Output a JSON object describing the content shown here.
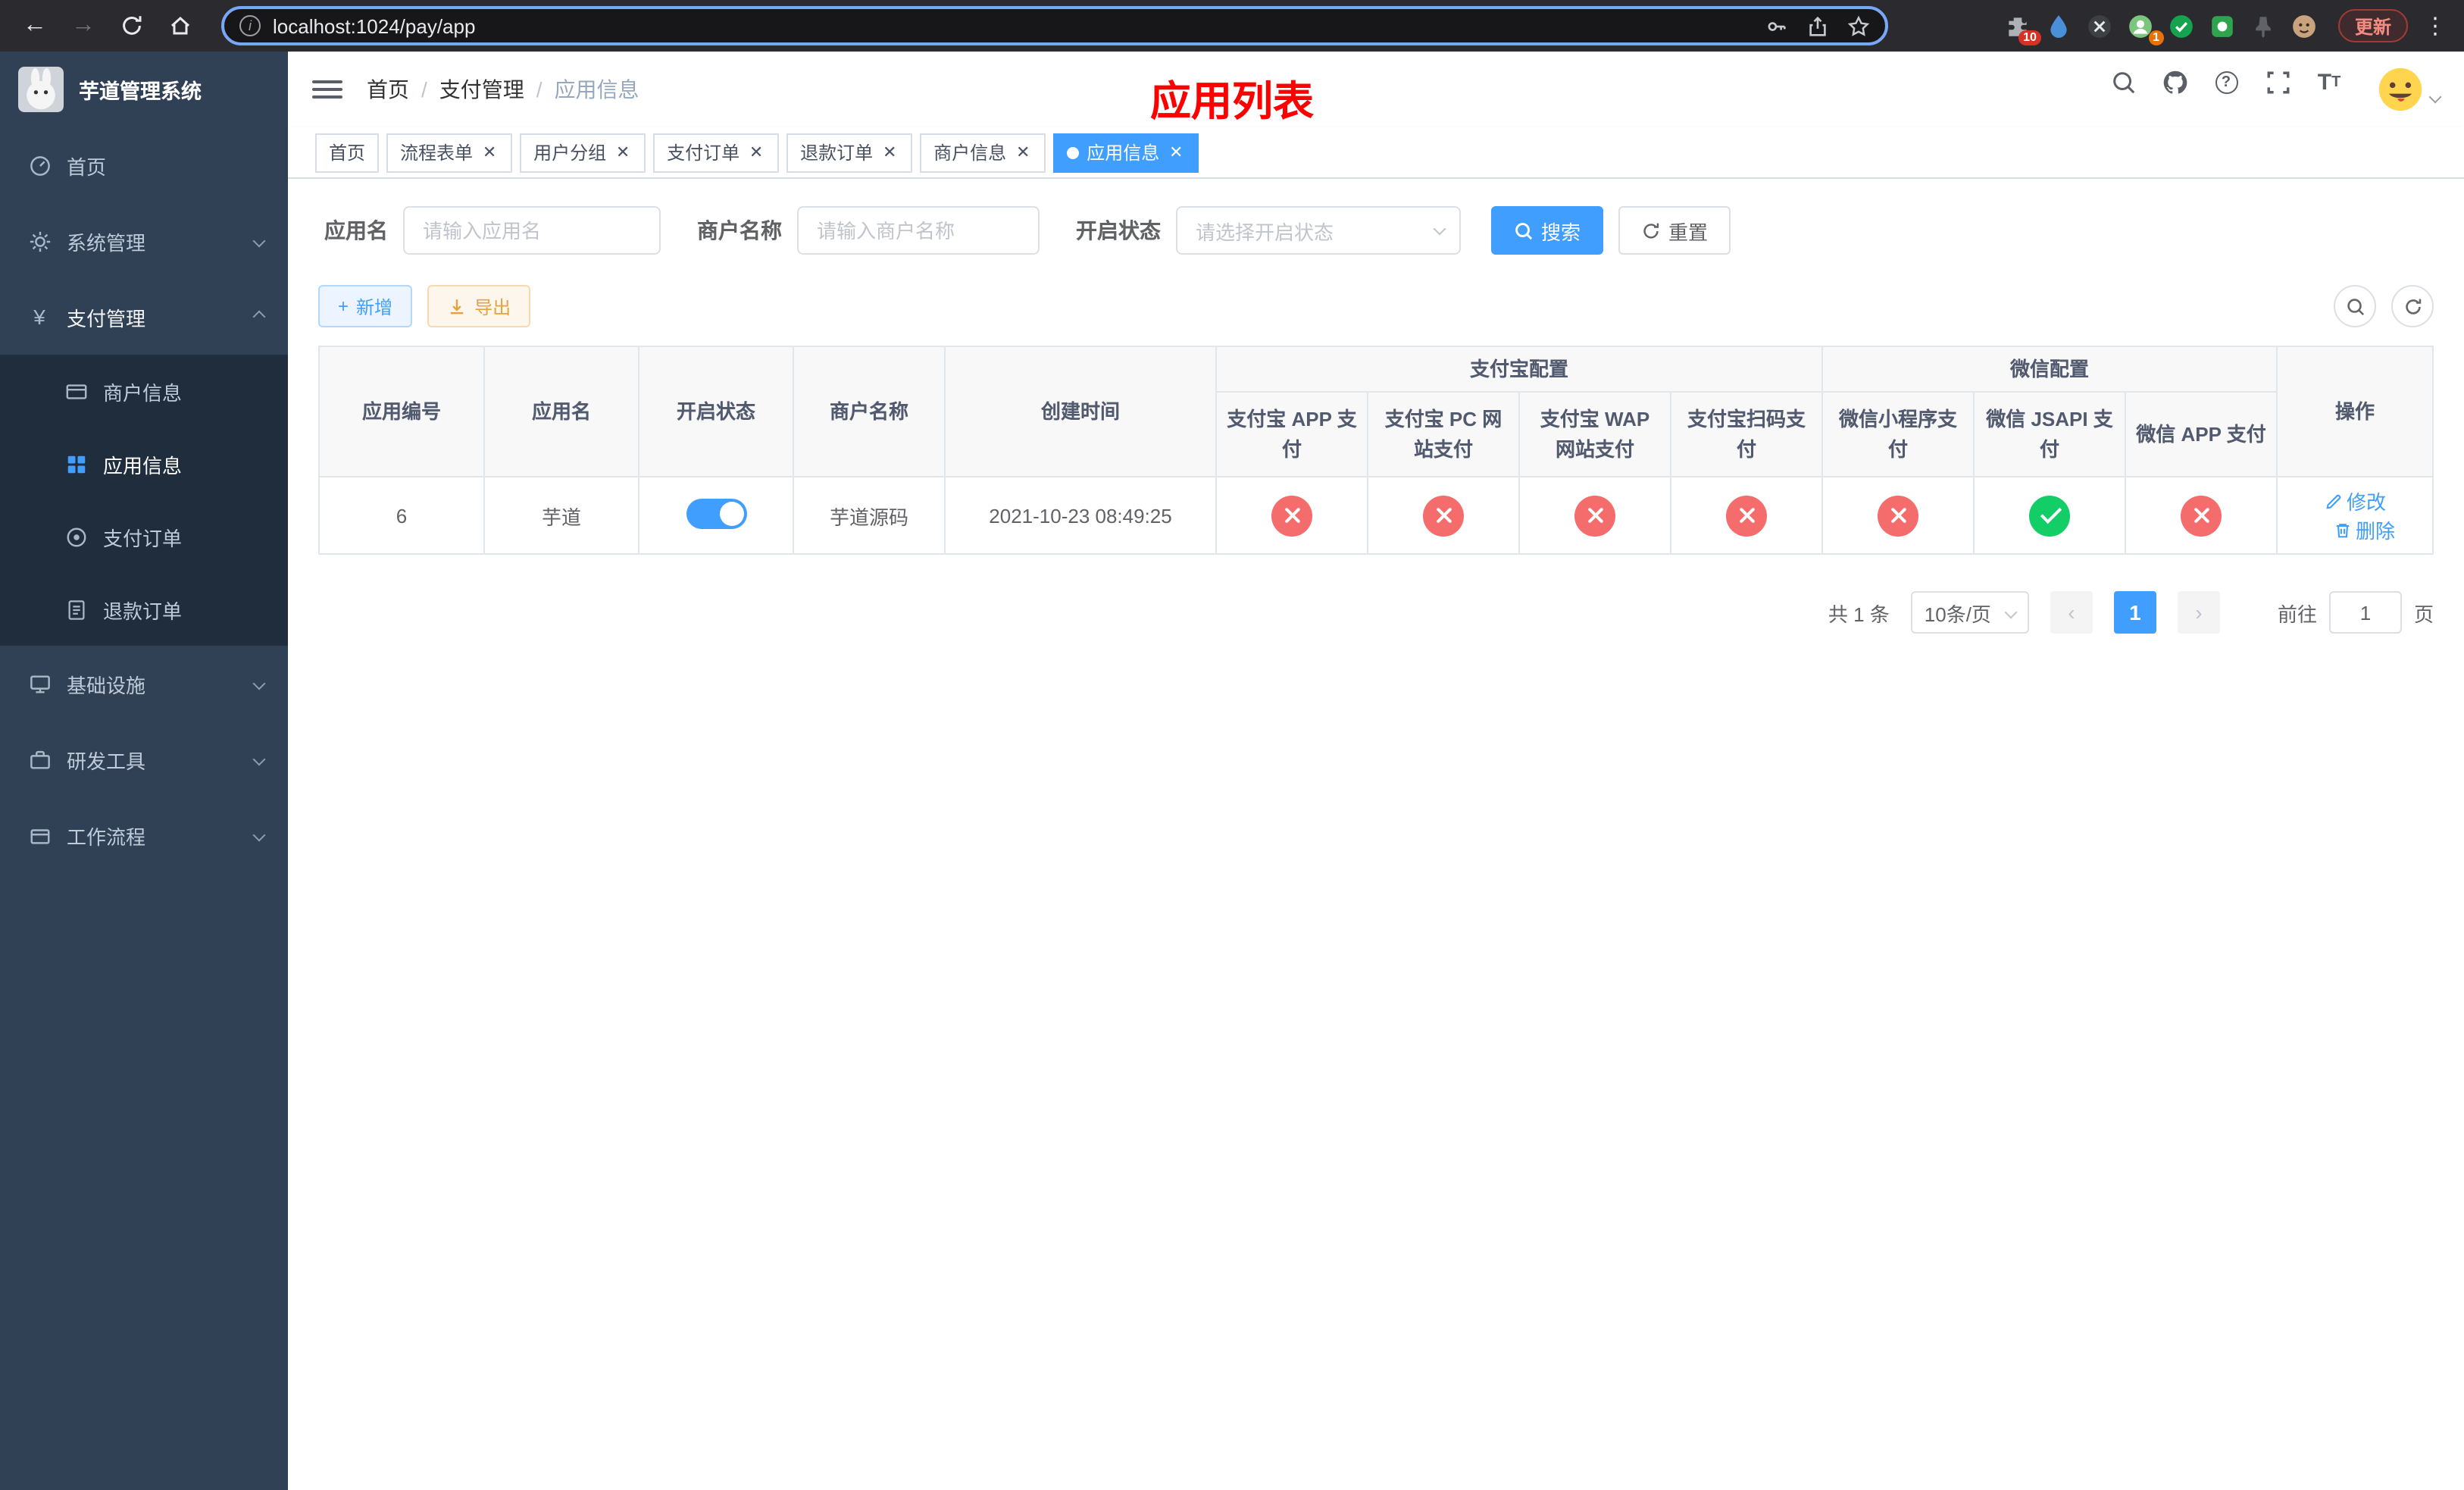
{
  "browser": {
    "url": "localhost:1024/pay/app",
    "update_label": "更新",
    "extensions_badge": "10",
    "profile_badge": "1"
  },
  "glyphs": {
    "back": "←",
    "forward": "→",
    "kebab": "⋮",
    "plus": "+",
    "yen": "¥",
    "slash": "/",
    "prev": "‹",
    "next": "›"
  },
  "sidebar": {
    "logo_title": "芋道管理系统",
    "home": "首页",
    "system": "系统管理",
    "payment": "支付管理",
    "merchant_info": "商户信息",
    "app_info": "应用信息",
    "pay_order": "支付订单",
    "refund_order": "退款订单",
    "infra": "基础设施",
    "dev_tools": "研发工具",
    "workflow": "工作流程"
  },
  "navbar": {
    "breadcrumb": [
      "首页",
      "支付管理",
      "应用信息"
    ],
    "page_title": "应用列表"
  },
  "tabs": [
    {
      "label": "首页"
    },
    {
      "label": "流程表单"
    },
    {
      "label": "用户分组"
    },
    {
      "label": "支付订单"
    },
    {
      "label": "退款订单"
    },
    {
      "label": "商户信息"
    },
    {
      "label": "应用信息"
    }
  ],
  "filters": {
    "app_name_label": "应用名",
    "app_name_placeholder": "请输入应用名",
    "merchant_label": "商户名称",
    "merchant_placeholder": "请输入商户名称",
    "status_label": "开启状态",
    "status_placeholder": "请选择开启状态",
    "search_button": "搜索",
    "reset_button": "重置"
  },
  "actions": {
    "add": "新增",
    "export": "导出"
  },
  "table": {
    "col_app_id": "应用编号",
    "col_app_name": "应用名",
    "col_status": "开启状态",
    "col_merchant": "商户名称",
    "col_created": "创建时间",
    "group_alipay": "支付宝配置",
    "group_wechat": "微信配置",
    "col_alipay_app": "支付宝 APP 支付",
    "col_alipay_pc": "支付宝 PC 网站支付",
    "col_alipay_wap": "支付宝 WAP 网站支付",
    "col_alipay_qr": "支付宝扫码支付",
    "col_wx_mini": "微信小程序支付",
    "col_wx_jsapi": "微信 JSAPI 支付",
    "col_wx_app": "微信 APP 支付",
    "col_actions": "操作",
    "row": {
      "id": "6",
      "name": "芋道",
      "status_on": true,
      "merchant": "芋道源码",
      "created": "2021-10-23 08:49:25",
      "configs": [
        false,
        false,
        false,
        false,
        false,
        true,
        false
      ],
      "edit": "修改",
      "delete": "删除"
    }
  },
  "pagination": {
    "total": "共 1 条",
    "page_size": "10条/页",
    "page": "1",
    "goto": "前往",
    "goto_value": "1",
    "unit": "页"
  },
  "colors": {
    "primary": "#409eff",
    "success": "#13ce66",
    "danger": "#f56c6c",
    "warning": "#e6a23c",
    "sidebar": "#304156",
    "title_red": "#ff0000"
  }
}
